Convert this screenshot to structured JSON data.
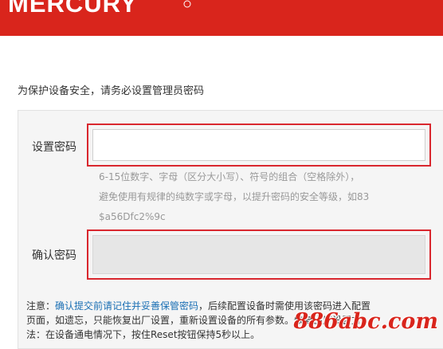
{
  "header": {
    "logo": "MERCURY"
  },
  "intro_text": "为保护设备安全，请务必设置管理员密码",
  "form": {
    "password_label": "设置密码",
    "password_value": "",
    "confirm_label": "确认密码",
    "confirm_value": "",
    "hint_lines": [
      "6-15位数字、字母（区分大小写）、符号的组合（空格除外），",
      "避免使用有规律的纯数字或字母，以提升密码的安全等级，如83",
      "$a56Dfc2%9c"
    ]
  },
  "notice": {
    "prefix": "注意：",
    "emphasis": "确认提交前请记住并妥善保管密码",
    "line1_rest": "，后续配置设备时需使用该密码进入配置",
    "line2": "页面，如遗忘，只能恢复出厂设置，重新设置设备的所有参数。恢复出厂设置方",
    "line3": "法：在设备通电情况下，按住Reset按钮保持5秒以上。"
  },
  "watermark": "886abc.com",
  "colors": {
    "brand_red": "#d9251c",
    "highlight_red": "#d9272e",
    "link_blue": "#1a6fb4"
  }
}
